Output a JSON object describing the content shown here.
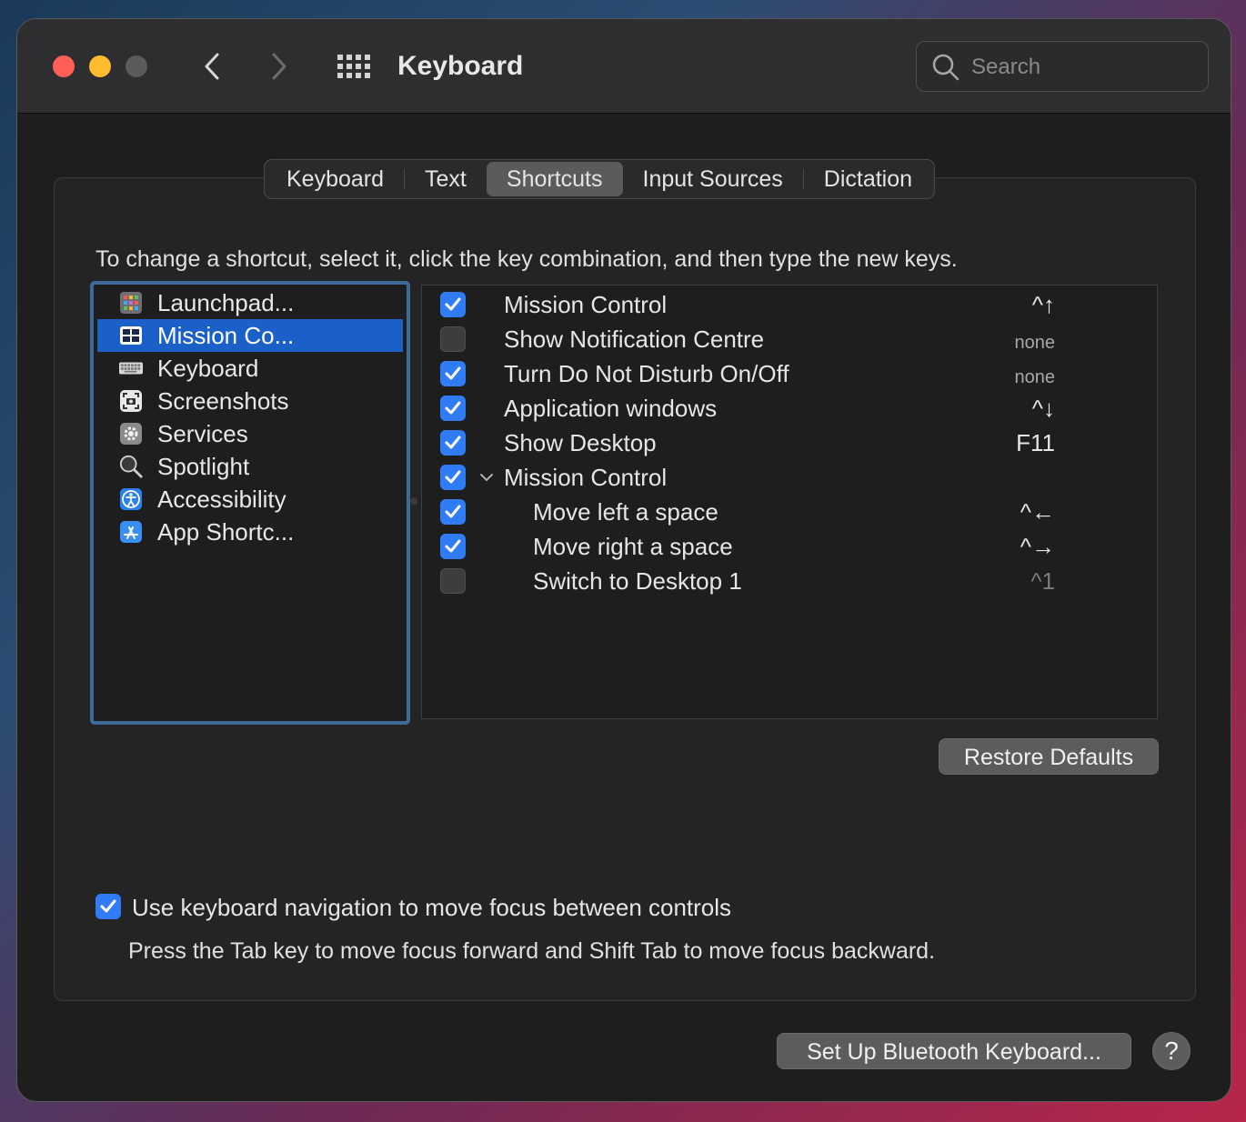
{
  "window": {
    "title": "Keyboard",
    "search_placeholder": "Search"
  },
  "tabs": [
    {
      "label": "Keyboard",
      "active": false
    },
    {
      "label": "Text",
      "active": false
    },
    {
      "label": "Shortcuts",
      "active": true
    },
    {
      "label": "Input Sources",
      "active": false
    },
    {
      "label": "Dictation",
      "active": false
    }
  ],
  "instruction": "To change a shortcut, select it, click the key combination, and then type the new keys.",
  "categories": [
    {
      "label": "Launchpad...",
      "icon": "launchpad-icon",
      "selected": false
    },
    {
      "label": "Mission Co...",
      "icon": "mission-control-icon",
      "selected": true
    },
    {
      "label": "Keyboard",
      "icon": "keyboard-icon",
      "selected": false
    },
    {
      "label": "Screenshots",
      "icon": "screenshot-icon",
      "selected": false
    },
    {
      "label": "Services",
      "icon": "gear-icon",
      "selected": false
    },
    {
      "label": "Spotlight",
      "icon": "magnifier-icon",
      "selected": false
    },
    {
      "label": "Accessibility",
      "icon": "accessibility-icon",
      "selected": false
    },
    {
      "label": "App Shortc...",
      "icon": "app-store-icon",
      "selected": false
    }
  ],
  "shortcuts": [
    {
      "label": "Mission Control",
      "key": "^↑",
      "checked": true,
      "indent": 0
    },
    {
      "label": "Show Notification Centre",
      "key": "none",
      "checked": false,
      "indent": 0
    },
    {
      "label": "Turn Do Not Disturb On/Off",
      "key": "none",
      "checked": true,
      "indent": 0
    },
    {
      "label": "Application windows",
      "key": "^↓",
      "checked": true,
      "indent": 0
    },
    {
      "label": "Show Desktop",
      "key": "F11",
      "checked": true,
      "indent": 0
    },
    {
      "label": "Mission Control",
      "key": "",
      "checked": true,
      "indent": 0,
      "group": true
    },
    {
      "label": "Move left a space",
      "key": "^←",
      "checked": true,
      "indent": 1
    },
    {
      "label": "Move right a space",
      "key": "^→",
      "checked": true,
      "indent": 1
    },
    {
      "label": "Switch to Desktop 1",
      "key": "^1",
      "checked": false,
      "indent": 1
    }
  ],
  "buttons": {
    "restore_defaults": "Restore Defaults",
    "bluetooth": "Set Up Bluetooth Keyboard...",
    "help": "?"
  },
  "keyboard_nav": {
    "label": "Use keyboard navigation to move focus between controls",
    "checked": true,
    "hint": "Press the Tab key to move focus forward and Shift Tab to move focus backward."
  },
  "colors": {
    "accent": "#2f7cf6",
    "selection": "#1b5fc9",
    "close": "#ff5f57",
    "minimize": "#febc2e"
  }
}
